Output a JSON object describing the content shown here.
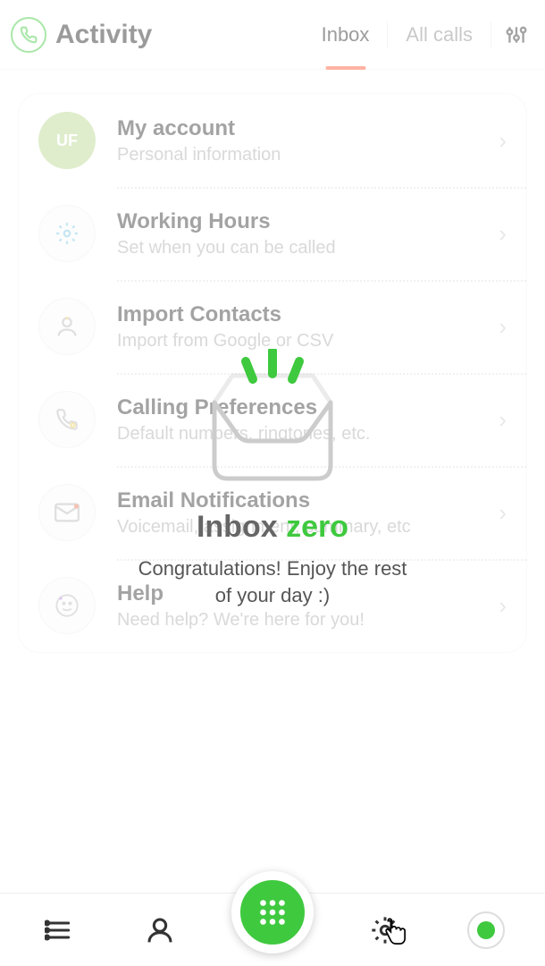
{
  "header": {
    "title": "Activity",
    "tabs": {
      "inbox": "Inbox",
      "all": "All calls"
    }
  },
  "settings": [
    {
      "avatar": "UF",
      "title": "My account",
      "sub": "Personal information"
    },
    {
      "icon": "gear",
      "title": "Working Hours",
      "sub": "Set when you can be called"
    },
    {
      "icon": "person",
      "title": "Import Contacts",
      "sub": "Import from Google or CSV"
    },
    {
      "icon": "phone",
      "title": "Calling Preferences",
      "sub": "Default numbers, ringtones, etc."
    },
    {
      "icon": "mail",
      "title": "Email Notifications",
      "sub": "Voicemail, assignment, summary, etc"
    },
    {
      "icon": "help",
      "title": "Help",
      "sub": "Need help? We're here for you!"
    }
  ],
  "inboxZero": {
    "titleA": "Inbox",
    "titleB": "zero",
    "message": "Congratulations! Enjoy the rest of your day :)"
  },
  "colors": {
    "accent": "#3fc93f",
    "tabActive": "#ff5a36"
  }
}
